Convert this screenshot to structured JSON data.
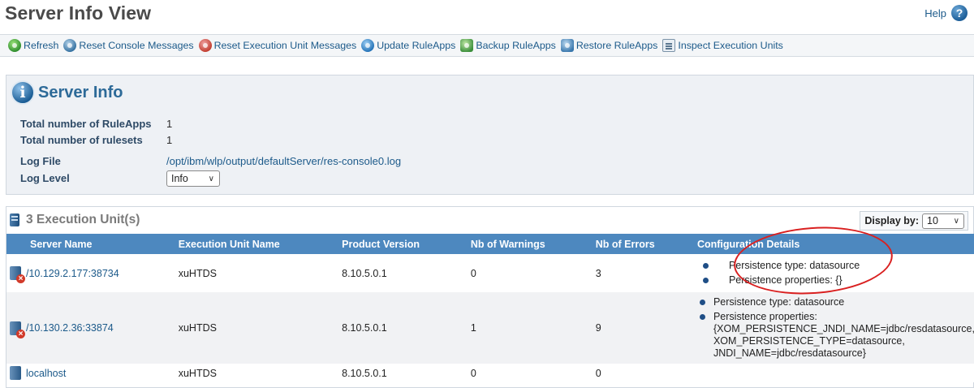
{
  "page": {
    "title": "Server Info View",
    "help_label": "Help",
    "help_icon": "question-icon"
  },
  "toolbar": {
    "items": [
      {
        "label": "Refresh",
        "icon": "refresh-icon"
      },
      {
        "label": "Reset Console Messages",
        "icon": "reset-console-icon"
      },
      {
        "label": "Reset Execution Unit Messages",
        "icon": "reset-execution-icon"
      },
      {
        "label": "Update RuleApps",
        "icon": "update-icon"
      },
      {
        "label": "Backup RuleApps",
        "icon": "backup-icon"
      },
      {
        "label": "Restore RuleApps",
        "icon": "restore-icon"
      },
      {
        "label": "Inspect Execution Units",
        "icon": "inspect-icon"
      }
    ]
  },
  "server_info": {
    "title": "Server Info",
    "icon": "info-icon",
    "rows": [
      {
        "label": "Total number of RuleApps",
        "value": "1"
      },
      {
        "label": "Total number of rulesets",
        "value": "1"
      },
      {
        "label": "Log File",
        "value": "/opt/ibm/wlp/output/defaultServer/res-console0.log"
      },
      {
        "label": "Log Level",
        "value": "Info"
      }
    ]
  },
  "execution_units": {
    "title": "3 Execution Unit(s)",
    "display_by_label": "Display by:",
    "display_by_value": "10",
    "columns": [
      "Server Name",
      "Execution Unit Name",
      "Product Version",
      "Nb of Warnings",
      "Nb of Errors",
      "Configuration Details"
    ],
    "rows": [
      {
        "server": "/10.129.2.177:38734",
        "status": "error",
        "unit": "xuHTDS",
        "version": "8.10.5.0.1",
        "warnings": "0",
        "errors": "3",
        "config": [
          "Persistence type: datasource",
          "Persistence properties: {}"
        ]
      },
      {
        "server": "/10.130.2.36:33874",
        "status": "error",
        "unit": "xuHTDS",
        "version": "8.10.5.0.1",
        "warnings": "1",
        "errors": "9",
        "config": [
          "Persistence type: datasource",
          "Persistence properties: {XOM_PERSISTENCE_JNDI_NAME=jdbc/resdatasource, XOM_PERSISTENCE_TYPE=datasource, JNDI_NAME=jdbc/resdatasource}"
        ]
      },
      {
        "server": "localhost",
        "status": "ok",
        "unit": "xuHTDS",
        "version": "8.10.5.0.1",
        "warnings": "0",
        "errors": "0",
        "config": []
      }
    ]
  },
  "colors": {
    "header_blue": "#4d88bf",
    "link": "#1c5a8a",
    "annotation_red": "#d92020"
  }
}
